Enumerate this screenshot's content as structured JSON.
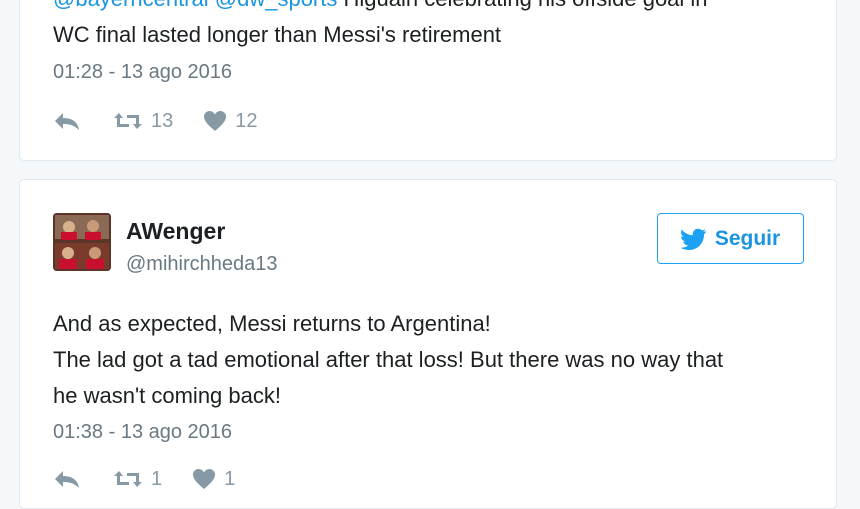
{
  "tweets": [
    {
      "mention1": "@bayerncentral",
      "mention2": "@dw_sports",
      "text_rest": " Higuain celebrating his offside goal in",
      "text_line2": "WC final lasted longer than Messi's retirement",
      "timestamp": "01:28 - 13 ago 2016",
      "retweets": "13",
      "likes": "12"
    },
    {
      "author_name": "AWenger",
      "author_handle": "@mihirchheda13",
      "follow_label": "Seguir",
      "text": "And as expected, Messi returns to Argentina!\nThe lad got a tad emotional after that loss! But there was no way that\nhe wasn't coming back!",
      "timestamp": "01:38 - 13 ago 2016",
      "retweets": "1",
      "likes": "1"
    }
  ],
  "colors": {
    "link": "#1b95e0",
    "muted": "#697882",
    "icon": "#8899a6",
    "border": "#e1e8ed"
  },
  "icons": [
    "reply-icon",
    "retweet-icon",
    "heart-icon",
    "twitter-bird-icon"
  ]
}
